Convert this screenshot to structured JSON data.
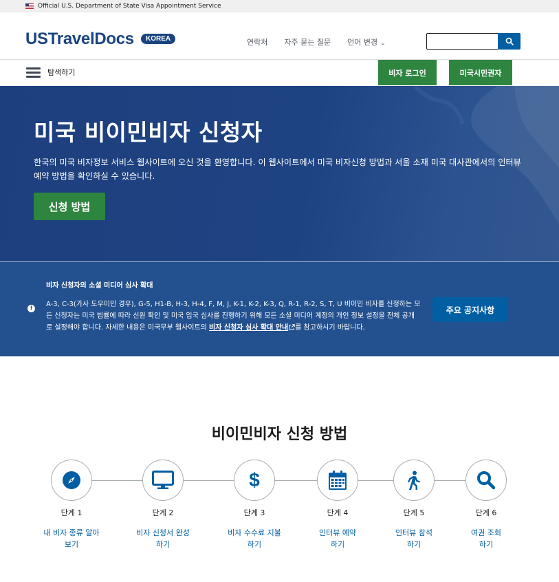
{
  "gov_banner": {
    "text": "Official U.S. Department of State Visa Appointment Service"
  },
  "header": {
    "logo": "USTravelDocs",
    "country_badge": "KOREA",
    "nav": {
      "contact": "연락처",
      "faq": "자주 묻는 질문",
      "language": "언어 변경"
    },
    "search": {
      "placeholder": "",
      "value": ""
    }
  },
  "subnav": {
    "menu_label": "탐색하기",
    "visa_login": "비자 로그인",
    "us_citizens": "미국시민권자"
  },
  "hero": {
    "title": "미국 비이민비자 신청자",
    "text": "한국의 미국 비자정보 서비스 웹사이트에 오신 것을 환영합니다. 이 웹사이트에서 미국 비자신청 방법과 서울 소재 미국 대사관에서의 인터뷰 예약 방법을 확인하실 수 있습니다.",
    "cta": "신청 방법"
  },
  "alert": {
    "title": "비자 신청자의 소셜 미디어 심사 확대",
    "body_before": "A-3, C-3(가사 도우미인 경우), G-5, H1-B, H-3, H-4, F, M, J, K-1, K-2, K-3, Q, R-1, R-2, S, T, U 비이민 비자를 신청하는 모든 신청자는 미국 법률에 따라 신원 확인 및 미국 입국 심사를 진행하기 위해 모든 소셜 미디어 계정의 개인 정보 설정을 전체 공개로 설정해야 합니다. 자세한 내용은 미국무부 웹사이트의 ",
    "link_text": "비자 신청자 심사 확대 안내",
    "body_after": "를 참고하시기 바랍니다.",
    "button": "주요 공지사항"
  },
  "steps": {
    "title": "비이민비자 신청 방법",
    "items": [
      {
        "number": "단계 1",
        "label_line1": "내 비자 종류 알아",
        "label_line2": "보기",
        "icon": "compass-icon"
      },
      {
        "number": "단계 2",
        "label_line1": "비자 신청서 완성",
        "label_line2": "하기",
        "icon": "monitor-icon"
      },
      {
        "number": "단계 3",
        "label_line1": "비자 수수료 지불",
        "label_line2": "하기",
        "icon": "dollar-icon"
      },
      {
        "number": "단계 4",
        "label_line1": "인터뷰 예약",
        "label_line2": "하기",
        "icon": "calendar-icon"
      },
      {
        "number": "단계 5",
        "label_line1": "인터뷰 참석",
        "label_line2": "하기",
        "icon": "walking-person-icon"
      },
      {
        "number": "단계 6",
        "label_line1": "여권 조회",
        "label_line2": "하기",
        "icon": "magnifier-icon"
      }
    ]
  },
  "colors": {
    "brand_blue": "#1a4480",
    "link_blue": "#005ea2",
    "green": "#2e8540",
    "hero_blue": "#1e4383",
    "alert_blue": "#23508e"
  }
}
